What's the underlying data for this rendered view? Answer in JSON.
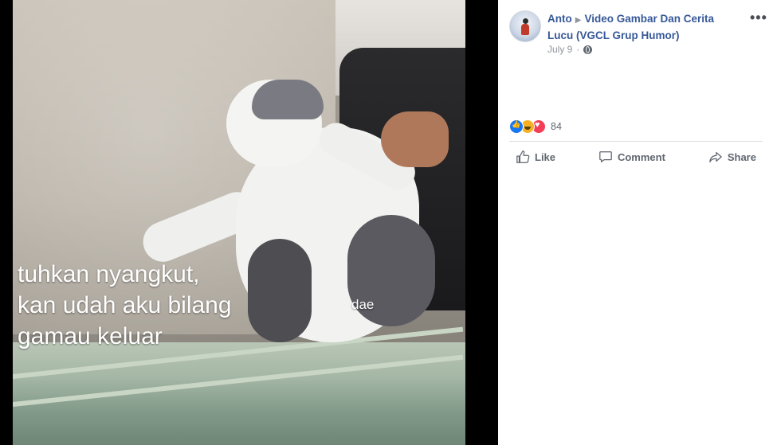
{
  "photo": {
    "caption_lines": [
      "tuhkan nyangkut,",
      "kan udah aku bilang",
      "gamau keluar"
    ],
    "watermark": "dae"
  },
  "post": {
    "author": "Anto",
    "group": "Video Gambar Dan Cerita Lucu (VGCL Grup Humor)",
    "date": "July 9",
    "privacy_icon": "globe-icon",
    "more_icon": "more-options-icon"
  },
  "reactions": {
    "icons": [
      "like",
      "haha",
      "love"
    ],
    "count": "84"
  },
  "actions": {
    "like": "Like",
    "comment": "Comment",
    "share": "Share"
  },
  "colors": {
    "link_blue": "#365899",
    "meta_grey": "#90949c",
    "action_grey": "#606770",
    "like_blue": "#1877f2",
    "haha_yellow": "#f7b125",
    "love_red": "#f33e58"
  }
}
